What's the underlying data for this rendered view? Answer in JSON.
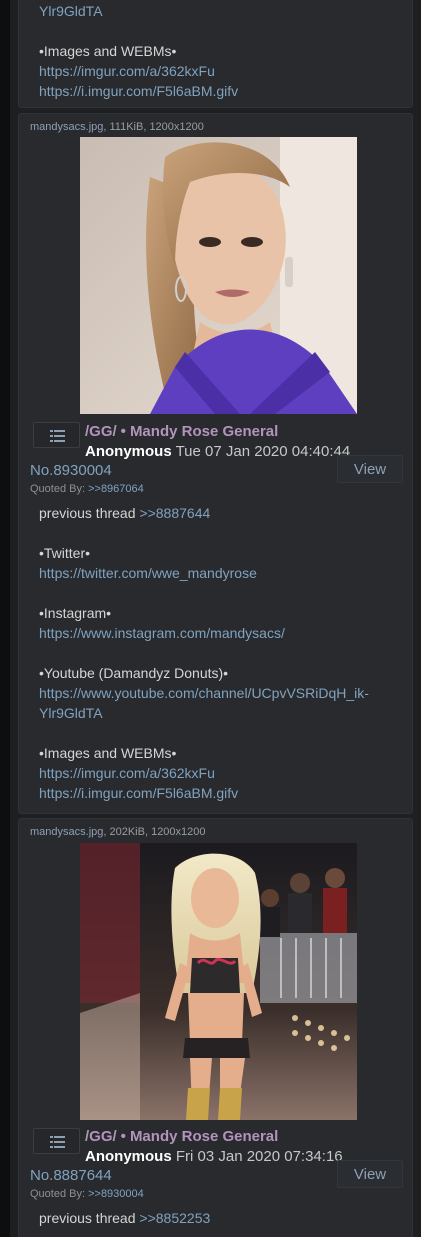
{
  "top_post": {
    "tail_link": "Ylr9GldTA",
    "images_header": "•Images and WEBMs•",
    "imgur_album": "https://imgur.com/a/362kxFu",
    "imgur_gifv": "https://i.imgur.com/F5l6aBM.gifv"
  },
  "posts": [
    {
      "file_name": "mandysacs.jpg",
      "file_meta": ", 111KiB, 1200x1200",
      "board": "/GG/",
      "dot": "•",
      "subject": "Mandy Rose General",
      "name": "Anonymous",
      "datetime": "Tue 07 Jan 2020 04:40:44",
      "post_no": "No.8930004",
      "view_label": "View",
      "quoted_by_label": "Quoted By: ",
      "quoted_by_link": ">>8967064",
      "prev_label": "previous thread ",
      "prev_link": ">>8887644",
      "twitter_header": "•Twitter•",
      "twitter_link": "https://twitter.com/wwe_mandyrose",
      "instagram_header": "•Instagram•",
      "instagram_link": "https://www.instagram.com/mandysacs/",
      "youtube_header": "•Youtube (Damandyz Donuts)•",
      "youtube_link_1": "https://www.youtube.com/channel/UCpvVSRiDqH_ik-",
      "youtube_link_2": "Ylr9GldTA",
      "images_header": "•Images and WEBMs•",
      "imgur_album": "https://imgur.com/a/362kxFu",
      "imgur_gifv": "https://i.imgur.com/F5l6aBM.gifv"
    },
    {
      "file_name": "mandysacs.jpg",
      "file_meta": ", 202KiB, 1200x1200",
      "board": "/GG/",
      "dot": "•",
      "subject": "Mandy Rose General",
      "name": "Anonymous",
      "datetime": "Fri 03 Jan 2020 07:34:16",
      "post_no": "No.8887644",
      "view_label": "View",
      "quoted_by_label": "Quoted By: ",
      "quoted_by_link": ">>8930004",
      "prev_label": "previous thread ",
      "prev_link": ">>8852253"
    }
  ],
  "icons": {
    "menu": "list-menu-icon"
  },
  "colors": {
    "background": "#1d1f21",
    "post_bg": "#282a2e",
    "link": "#81a2be",
    "subject": "#b294bb",
    "name": "#ffffff"
  }
}
